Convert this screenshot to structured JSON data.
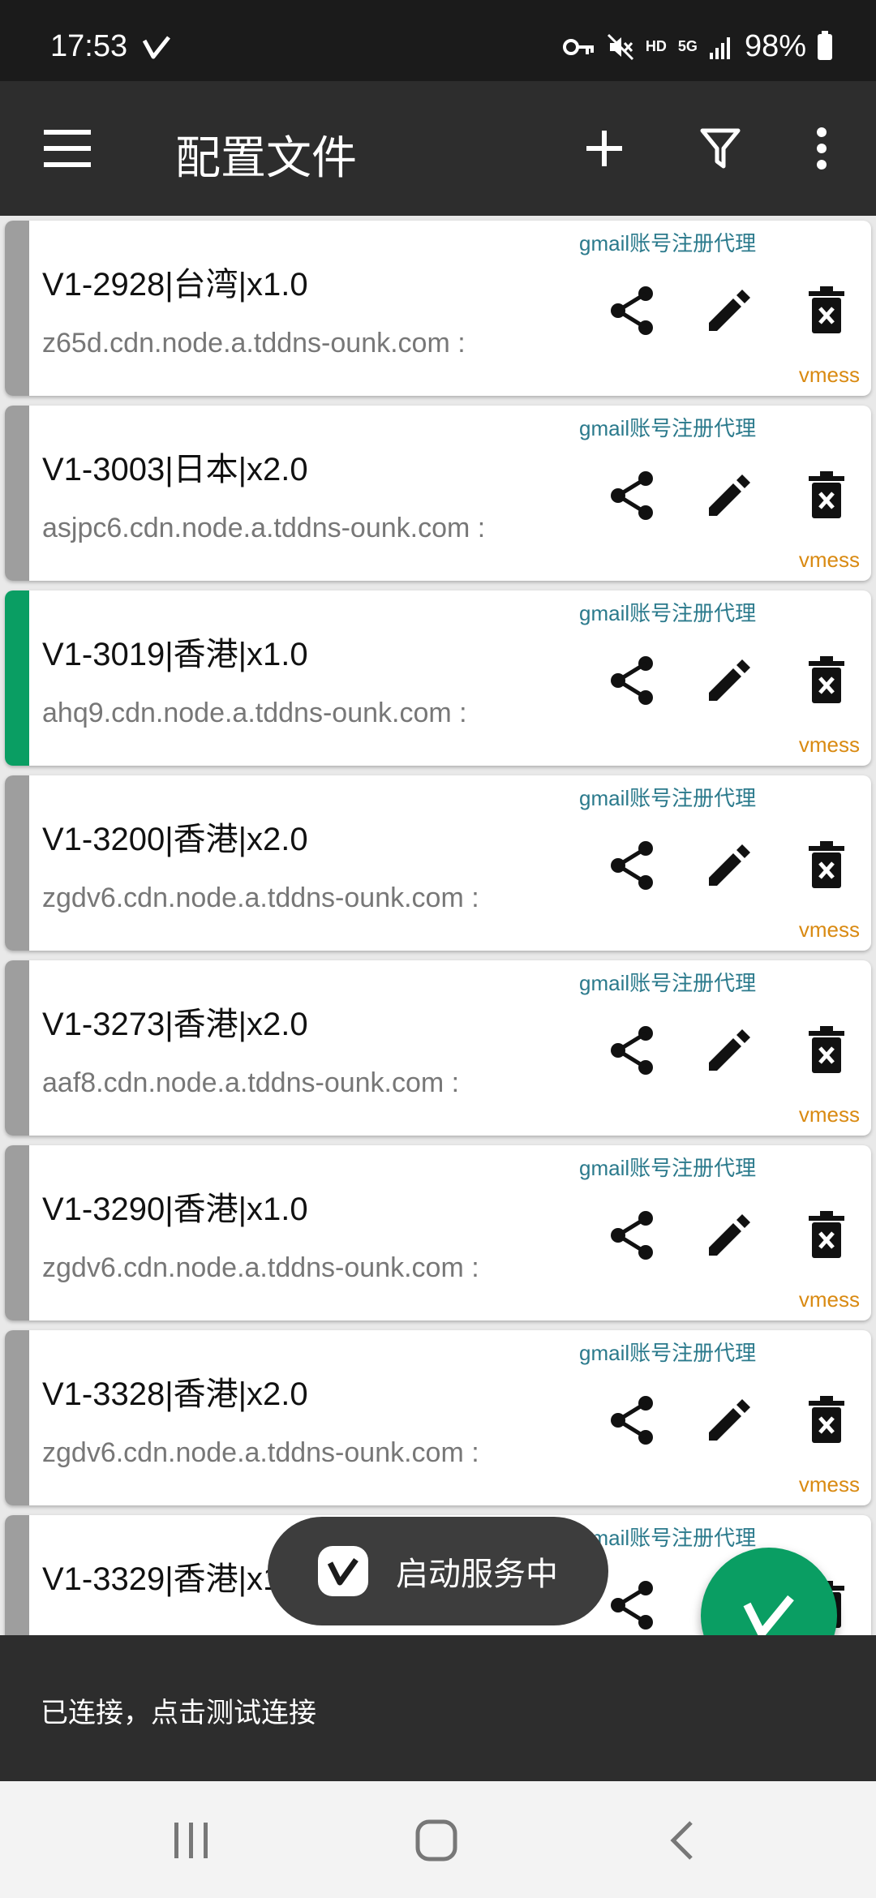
{
  "status_bar": {
    "time": "17:53",
    "hd_label": "HD",
    "net_label": "5G",
    "battery": "98%"
  },
  "app_bar": {
    "title": "配置文件",
    "actions": [
      "menu-icon",
      "add-icon",
      "filter-icon",
      "more-vert-icon"
    ]
  },
  "colors": {
    "active_indicator": "#0a9e63",
    "inactive_indicator": "#9e9e9e",
    "tag_text": "#2b7a8c",
    "type_text": "#d98a12"
  },
  "servers": [
    {
      "name": "V1-2928|台湾|x1.0",
      "address": "z65d.cdn.node.a.tddns-ounk.com :",
      "tag": "gmail账号注册代理",
      "type": "vmess",
      "active": false
    },
    {
      "name": "V1-3003|日本|x2.0",
      "address": "asjpc6.cdn.node.a.tddns-ounk.com :",
      "tag": "gmail账号注册代理",
      "type": "vmess",
      "active": false
    },
    {
      "name": "V1-3019|香港|x1.0",
      "address": "ahq9.cdn.node.a.tddns-ounk.com :",
      "tag": "gmail账号注册代理",
      "type": "vmess",
      "active": true
    },
    {
      "name": "V1-3200|香港|x2.0",
      "address": "zgdv6.cdn.node.a.tddns-ounk.com :",
      "tag": "gmail账号注册代理",
      "type": "vmess",
      "active": false
    },
    {
      "name": "V1-3273|香港|x2.0",
      "address": "aaf8.cdn.node.a.tddns-ounk.com :",
      "tag": "gmail账号注册代理",
      "type": "vmess",
      "active": false
    },
    {
      "name": "V1-3290|香港|x1.0",
      "address": "zgdv6.cdn.node.a.tddns-ounk.com :",
      "tag": "gmail账号注册代理",
      "type": "vmess",
      "active": false
    },
    {
      "name": "V1-3328|香港|x2.0",
      "address": "zgdv6.cdn.node.a.tddns-ounk.com :",
      "tag": "gmail账号注册代理",
      "type": "vmess",
      "active": false
    },
    {
      "name": "V1-3329|香港|x1.0",
      "address": "",
      "tag": "gmail账号注册代理",
      "type": "",
      "active": false
    }
  ],
  "toast": {
    "text": "启动服务中"
  },
  "bottom_bar": {
    "message": "已连接，点击测试连接"
  },
  "nav_bar": [
    "recent-apps-icon",
    "home-icon",
    "back-icon"
  ]
}
